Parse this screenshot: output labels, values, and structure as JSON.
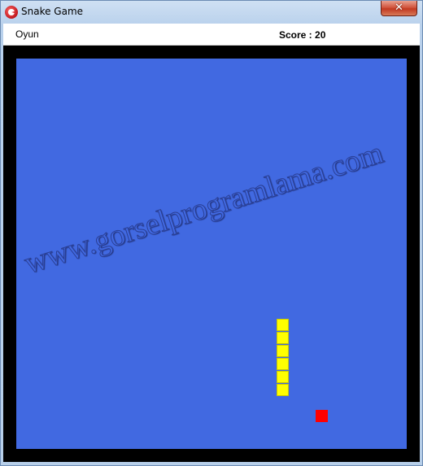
{
  "window": {
    "title": "Snake Game",
    "close_label": "✕"
  },
  "menu": {
    "items": [
      {
        "label": "Oyun"
      }
    ]
  },
  "score": {
    "text": "Score : 20"
  },
  "board": {
    "watermark": "www.gorselprogramlama.com",
    "background_color": "#4169e1"
  },
  "snake": {
    "color": "#ffff00",
    "segments": 6
  },
  "food": {
    "color": "#ff0000"
  }
}
